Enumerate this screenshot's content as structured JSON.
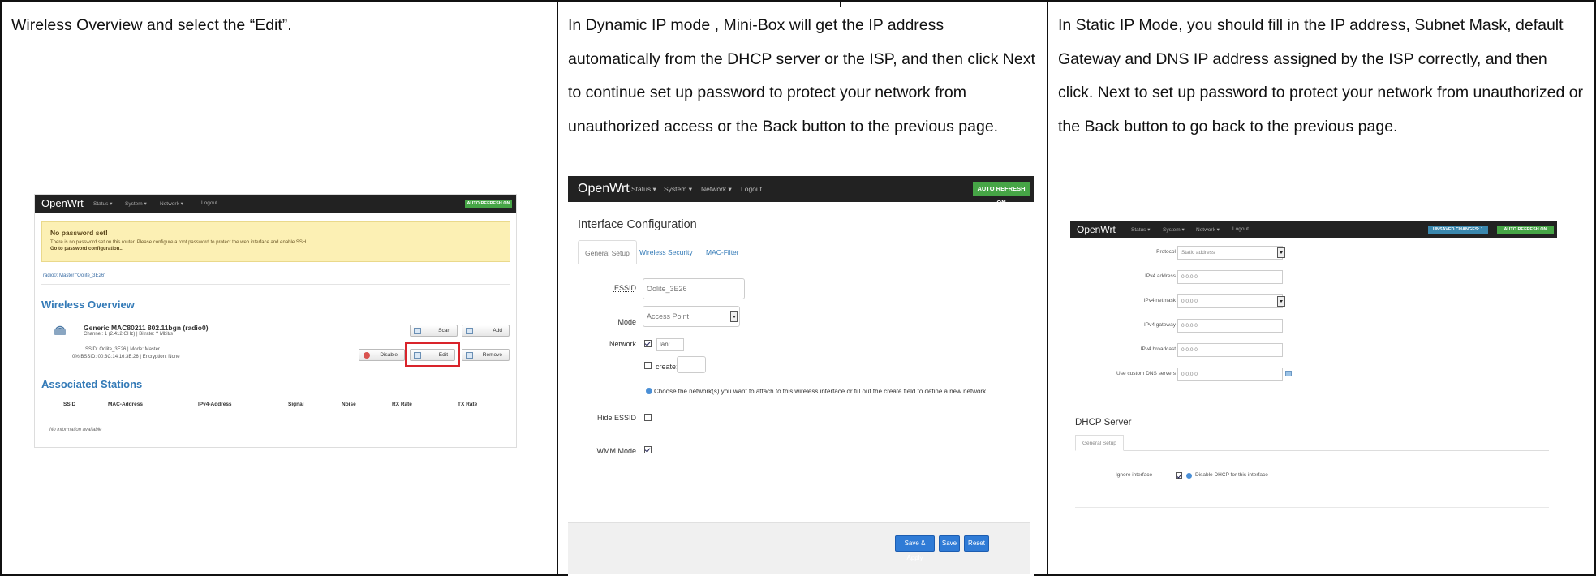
{
  "columns": [
    {
      "text": "Wireless Overview and select the “Edit”."
    },
    {
      "text": "In Dynamic IP mode , Mini-Box will get the IP address automatically from the DHCP server or the    ISP, and then click Next    to    continue set up password to protect your network from unauthorized access or the Back button to the previous page."
    },
    {
      "text": "In Static IP Mode, you should fill in the IP address, Subnet Mask, default Gateway and DNS IP address assigned by the ISP correctly, and then click. Next to set up password to protect your network from unauthorized or the Back button to go back to the previous page."
    }
  ],
  "shot1": {
    "brand": "OpenWrt",
    "menu": [
      "Status ▾",
      "System ▾",
      "Network ▾",
      "Logout"
    ],
    "autorefresh": "AUTO REFRESH ON",
    "alert_title": "No password set!",
    "alert_body": "There is no password set on this router. Please configure a root password to protect the web interface and enable SSH.",
    "alert_link": "Go to password configuration...",
    "breadcrumb": "radio0: Master \"Oolite_3E26\"",
    "heading_wireless": "Wireless Overview",
    "radio_name": "Generic MAC80211 802.11bgn (radio0)",
    "radio_info": "Channel: 1 (2.412 GHz) | Bitrate: ? Mbit/s",
    "ssid_line": "SSID: Oolite_3E26 | Mode: Master",
    "bssid_line": "0%  BSSID: 00:3C:14:16:3E:26 | Encryption: None",
    "buttons": {
      "scan": "Scan",
      "add": "Add",
      "disable": "Disable",
      "edit": "Edit",
      "remove": "Remove"
    },
    "heading_stations": "Associated Stations",
    "table_headers": [
      "SSID",
      "MAC-Address",
      "IPv4-Address",
      "Signal",
      "Noise",
      "RX Rate",
      "TX Rate"
    ],
    "no_info": "No information available"
  },
  "shot2": {
    "brand": "OpenWrt",
    "menu": [
      "Status ▾",
      "System ▾",
      "Network ▾",
      "Logout"
    ],
    "autorefresh": "AUTO REFRESH ON",
    "heading": "Interface Configuration",
    "tabs": [
      "General Setup",
      "Wireless Security",
      "MAC-Filter"
    ],
    "essid_label": "ESSID",
    "essid_value": "Oolite_3E26",
    "mode_label": "Mode",
    "mode_value": "Access Point",
    "network_label": "Network",
    "lan_label": "lan:",
    "create_label": "create:",
    "hint": "Choose the network(s) you want to attach to this wireless interface or fill out the create field to define a new network.",
    "hide_essid_label": "Hide ESSID",
    "wmm_label": "WMM Mode",
    "buttons": {
      "save_apply": "Save & Apply",
      "save": "Save",
      "reset": "Reset"
    }
  },
  "shot3": {
    "brand": "OpenWrt",
    "menu": [
      "Status ▾",
      "System ▾",
      "Network ▾",
      "Logout"
    ],
    "unsaved": "UNSAVED CHANGES: 1",
    "autorefresh": "AUTO REFRESH ON",
    "fields": [
      {
        "label": "Protocol",
        "value": "Static address"
      },
      {
        "label": "IPv4 address",
        "value": "0.0.0.0"
      },
      {
        "label": "IPv4 netmask",
        "value": "0.0.0.0"
      },
      {
        "label": "IPv4 gateway",
        "value": "0.0.0.0"
      },
      {
        "label": "IPv4 broadcast",
        "value": "0.0.0.0"
      },
      {
        "label": "Use custom DNS servers",
        "value": "0.0.0.0"
      }
    ],
    "dhcp_heading": "DHCP Server",
    "dhcp_tab": "General Setup",
    "ignore_label": "Ignore interface",
    "ignore_desc": "Disable DHCP for this interface"
  }
}
